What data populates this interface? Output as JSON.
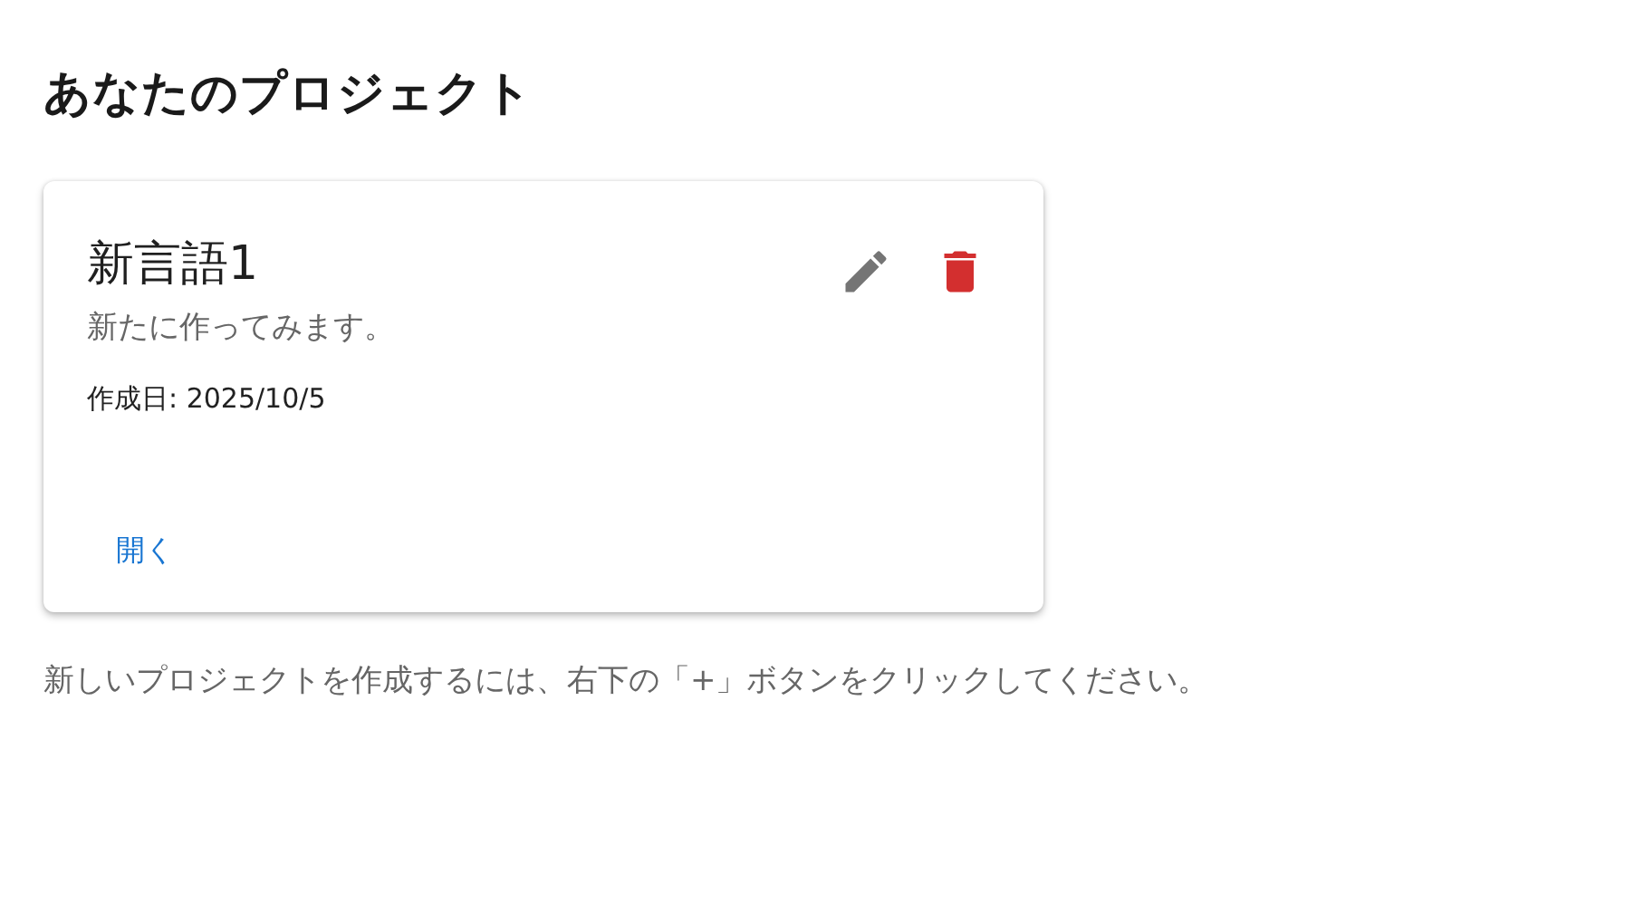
{
  "heading": "あなたのプロジェクト",
  "projects": [
    {
      "title": "新言語1",
      "description": "新たに作ってみます。",
      "created": "作成日: 2025/10/5",
      "open_label": "開く"
    }
  ],
  "hint": "新しいプロジェクトを作成するには、右下の「+」ボタンをクリックしてください。"
}
